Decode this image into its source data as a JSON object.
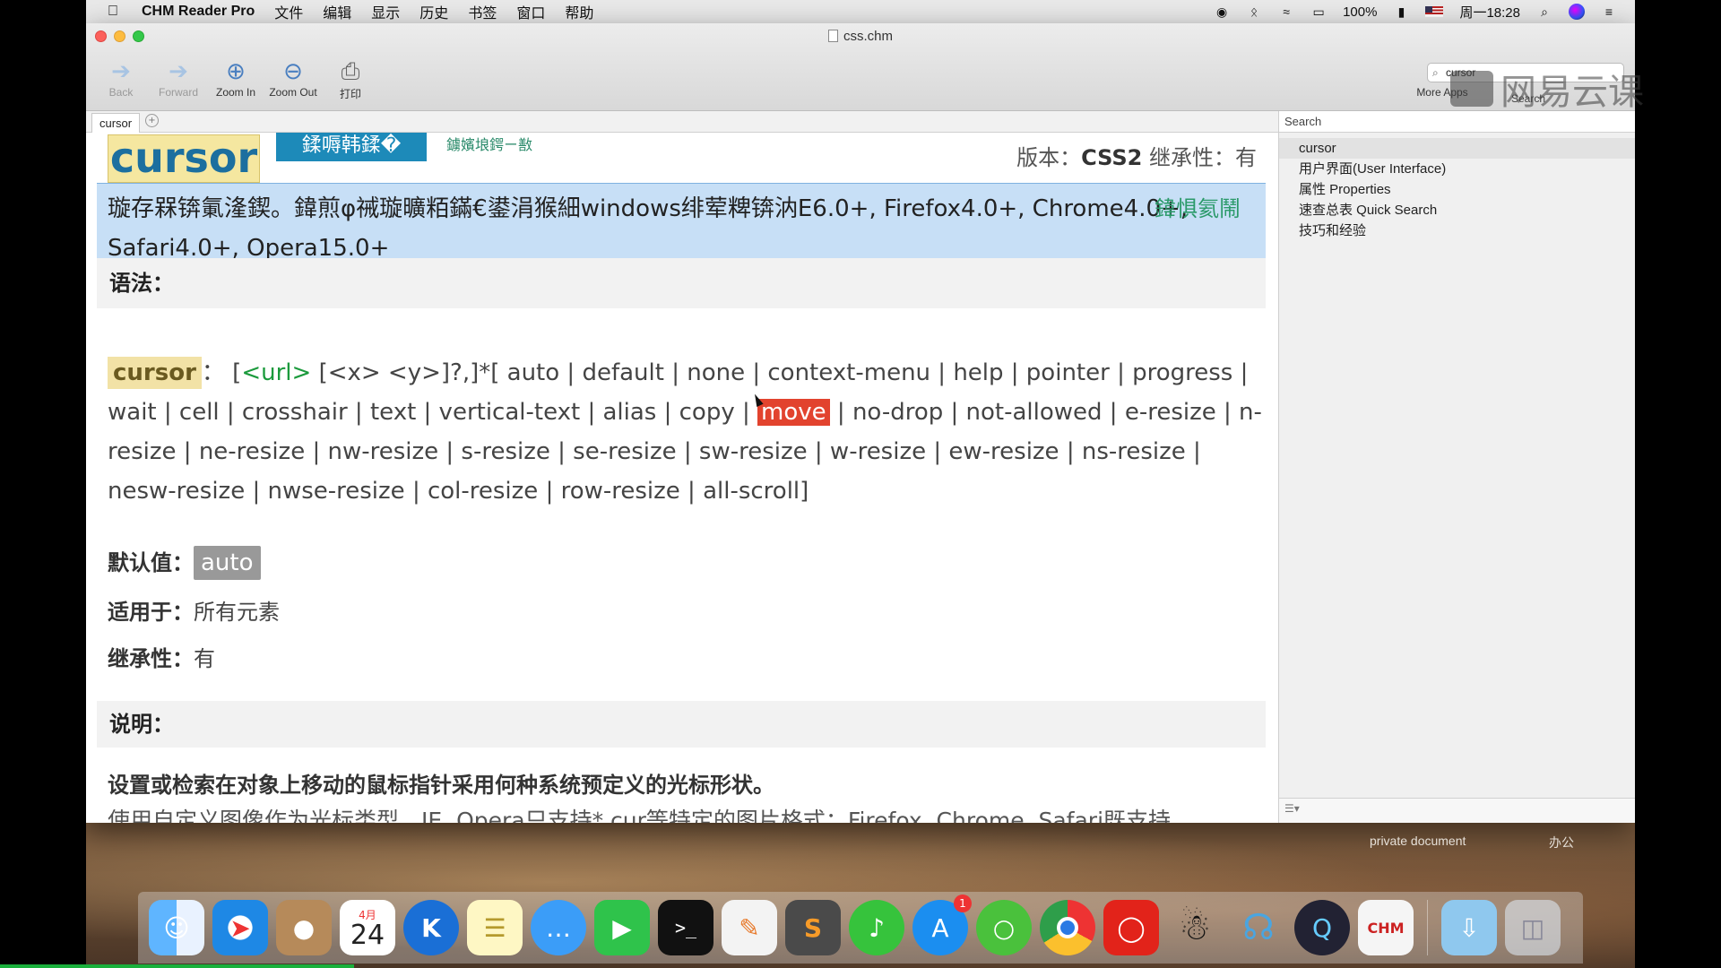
{
  "menubar": {
    "app_name": "CHM Reader Pro",
    "items": [
      "文件",
      "编辑",
      "显示",
      "历史",
      "书签",
      "窗口",
      "帮助"
    ],
    "battery": "100%",
    "clock": "周一18:28",
    "icons": [
      "record-icon",
      "bluetooth-icon",
      "wifi-icon",
      "airplay-icon",
      "battery-icon",
      "flag-icon",
      "search-icon",
      "siri-icon",
      "list-icon"
    ]
  },
  "window": {
    "title": "css.chm",
    "toolbar": {
      "back": "Back",
      "forward": "Forward",
      "zoom_in": "Zoom In",
      "zoom_out": "Zoom Out",
      "print": "打印",
      "more_apps": "More Apps",
      "search_label": "Search",
      "search_value": "cursor"
    },
    "watermark": "网易云课",
    "tab": {
      "label": "cursor"
    }
  },
  "content": {
    "title": "cursor",
    "garbled_tab": "鍒嗕韩鍒�",
    "garbled_link": "鐪嬪埌鍔ㄧ敾",
    "version_label": "版本：",
    "version_value": "CSS2",
    "inherit_label": "继承性：",
    "inherit_value": "有",
    "compat_text": "璇存槑锛氭湰鍥。鍏煎φ祴璇曠粨鏋€鍙涓猴細windows绯荤粺锛汭E6.0+, Firefox4.0+, Chrome4.0+, Safari4.0+, Opera15.0+",
    "compat_link": "鍏惧氦鬧",
    "syntax_heading": "语法：",
    "syntax_prop": "cursor",
    "syntax_url": "<url>",
    "syntax_pre": "[<x> <y>]?,]*[ auto | default | none | context-menu | help | pointer | progress | wait | cell | crosshair | text | vertical-text | alias | copy | ",
    "syntax_highlight": "move",
    "syntax_post": " | no-drop | not-allowed | e-resize | n-resize | ne-resize | nw-resize | s-resize | se-resize | sw-resize | w-resize | ew-resize | ns-resize | nesw-resize | nwse-resize | col-resize | row-resize | all-scroll]",
    "default_label": "默认值：",
    "default_value": "auto",
    "applies_label": "适用于：",
    "applies_value": "所有元素",
    "inherit_row_label": "继承性：",
    "inherit_row_value": "有",
    "desc_heading": "说明：",
    "desc_line1": "设置或检索在对象上移动的鼠标指针采用何种系统预定义的光标形状。",
    "desc_line2": "使用自定义图像作为光标类型，IE, Opera只支持*.cur等特定的图片格式；Firefox, Chrome, Safari既支持"
  },
  "sidebar": {
    "search_placeholder": "Search",
    "items": [
      "cursor",
      "用户界面(User Interface)",
      "属性 Properties",
      "速查总表 Quick Search",
      "技巧和经验"
    ]
  },
  "desktop": {
    "label1": "private document",
    "label2": "办公"
  },
  "dock": {
    "calendar_month": "4月",
    "calendar_day": "24",
    "appstore_badge": "1",
    "apps": [
      "finder-icon",
      "safari-icon",
      "contacts-icon",
      "calendar-icon",
      "kodi-icon",
      "notes-icon",
      "messages-icon",
      "facetime-icon",
      "terminal-icon",
      "pages-icon",
      "sublime-icon",
      "music-icon",
      "appstore-icon",
      "wechat-icon",
      "chrome-icon",
      "netease-music-icon",
      "qq-icon",
      "keynote-icon",
      "quicktime-icon",
      "chm-reader-icon",
      "downloads-icon",
      "trash-icon"
    ],
    "chm_label": "CHM"
  },
  "colors": {
    "accent": "#1c6f9f",
    "highlight": "#e2432e",
    "compat_bg": "#c7dff6",
    "title_bg": "#f5e7a0"
  }
}
